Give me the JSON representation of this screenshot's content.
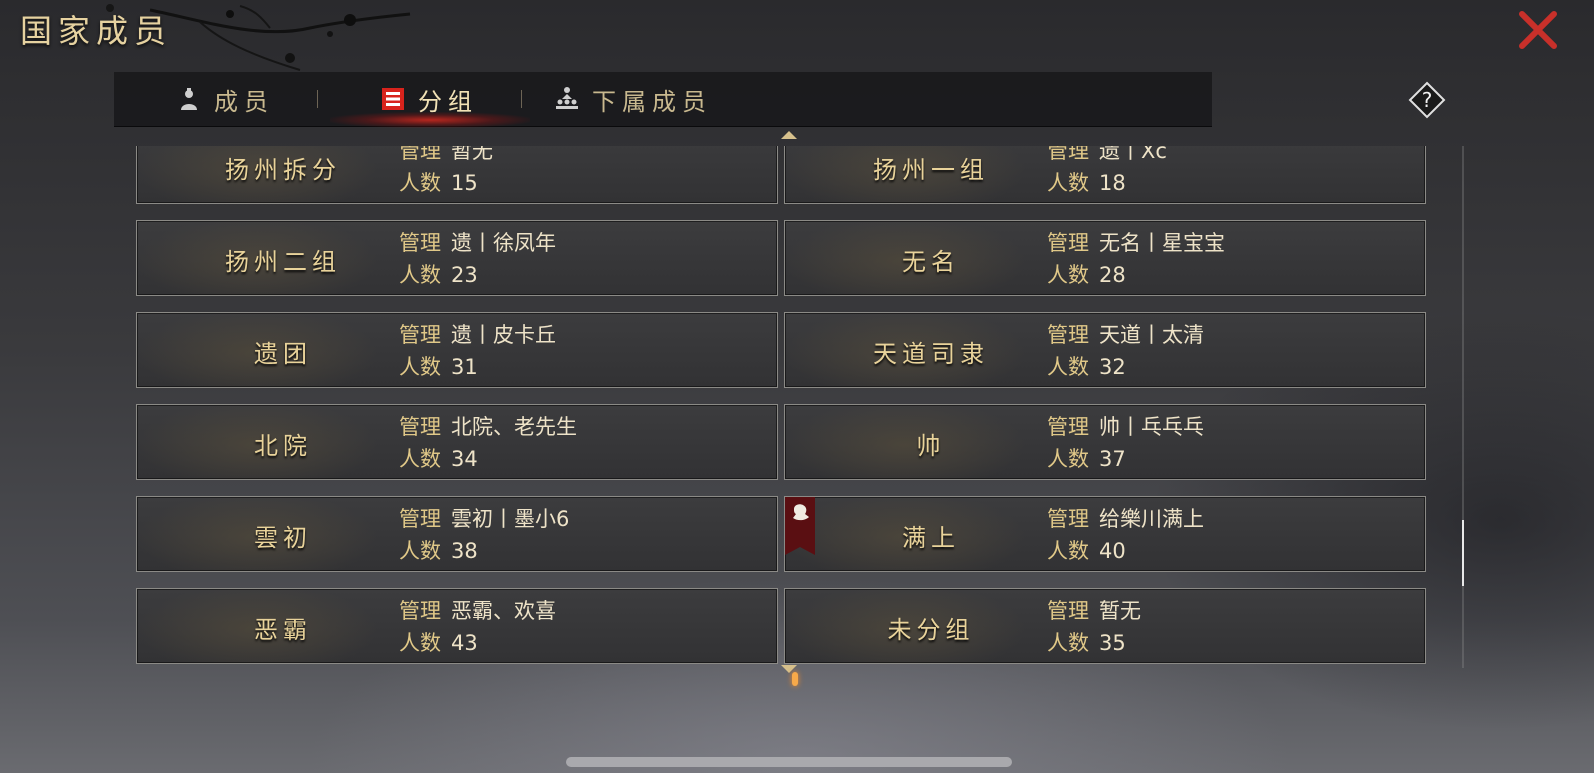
{
  "header": {
    "title": "国家成员"
  },
  "tabs": [
    {
      "label": "成员",
      "icon": "member-icon",
      "active": false
    },
    {
      "label": "分组",
      "icon": "group-list-icon",
      "active": true
    },
    {
      "label": "下属成员",
      "icon": "hierarchy-icon",
      "active": false
    }
  ],
  "groups": [
    {
      "name": "扬州拆分",
      "manager_label": "管理",
      "manager": "暂无",
      "count_label": "人数",
      "count": "15"
    },
    {
      "name": "扬州一组",
      "manager_label": "管理",
      "manager": "遗丨Xc",
      "count_label": "人数",
      "count": "18"
    },
    {
      "name": "扬州二组",
      "manager_label": "管理",
      "manager": "遗丨徐凤年",
      "count_label": "人数",
      "count": "23"
    },
    {
      "name": "无名",
      "manager_label": "管理",
      "manager": "无名丨星宝宝",
      "count_label": "人数",
      "count": "28"
    },
    {
      "name": "遗团",
      "manager_label": "管理",
      "manager": "遗丨皮卡丘",
      "count_label": "人数",
      "count": "31"
    },
    {
      "name": "天道司隶",
      "manager_label": "管理",
      "manager": "天道丨太清",
      "count_label": "人数",
      "count": "32"
    },
    {
      "name": "北院",
      "manager_label": "管理",
      "manager": "北院、老先生",
      "count_label": "人数",
      "count": "34"
    },
    {
      "name": "帅",
      "manager_label": "管理",
      "manager": "帅丨乓乓乓",
      "count_label": "人数",
      "count": "37"
    },
    {
      "name": "雲初",
      "manager_label": "管理",
      "manager": "雲初丨墨小6",
      "count_label": "人数",
      "count": "38"
    },
    {
      "name": "满上",
      "manager_label": "管理",
      "manager": "给樂川满上",
      "count_label": "人数",
      "count": "40",
      "badge": "own-group-badge-icon"
    },
    {
      "name": "恶霸",
      "manager_label": "管理",
      "manager": "恶霸、欢喜",
      "count_label": "人数",
      "count": "43"
    },
    {
      "name": "未分组",
      "manager_label": "管理",
      "manager": "暂无",
      "count_label": "人数",
      "count": "35"
    }
  ],
  "colors": {
    "gold_text": "#e9d39a",
    "close_red": "#c8302a",
    "active_tab_glow": "#d2281e"
  }
}
